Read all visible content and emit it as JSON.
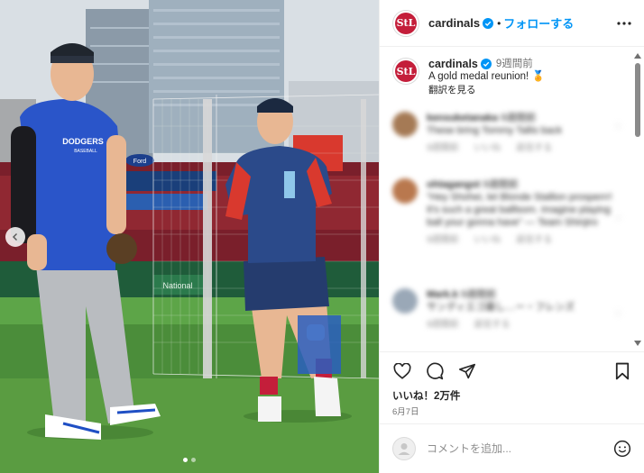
{
  "post": {
    "username": "cardinals",
    "follow_label": "フォローする",
    "separator": "•",
    "avatar_text": "StL",
    "caption_time": "9週間前",
    "caption_text": "A gold medal reunion! 🏅",
    "translate_label": "翻訳を見る",
    "likes": "いいね！2万件",
    "date": "6月7日",
    "comment_placeholder": "コメントを追加..."
  },
  "comments": [
    {
      "user": "kensuketanaka",
      "time": "9週間前",
      "text": "These bring Tommy Tallis back",
      "meta": "9週間前 いいね 返信する"
    },
    {
      "user": "ohtagangst",
      "time": "9週間前",
      "text": "\"Hey Shohei, let Blonde Stallion prosperrr! It's such a great balllsom. Imagine playing ball your gonna have\" — Team Shinjiro",
      "meta": "9週間前 いいね 返信する"
    },
    {
      "user": "Mark.k",
      "time": "9週間前",
      "text": "サンディエゴ最し…ー・フレンズ",
      "meta": "9週間前 返信する"
    }
  ],
  "photo_text": {
    "shirt": "DODGERS",
    "shirt_sub": "BASEBALL",
    "banner1": "Ford",
    "banner2": "National"
  },
  "colors": {
    "accent": "#0095f6",
    "cardinals_red": "#c41e3a",
    "dodger_blue": "#2a55c9"
  },
  "icons": [
    "more-icon",
    "verified-icon",
    "heart-icon",
    "comment-icon",
    "share-icon",
    "bookmark-icon",
    "emoji-icon",
    "chevron-left-icon",
    "chevron-up-icon",
    "chevron-down-icon",
    "user-icon"
  ]
}
